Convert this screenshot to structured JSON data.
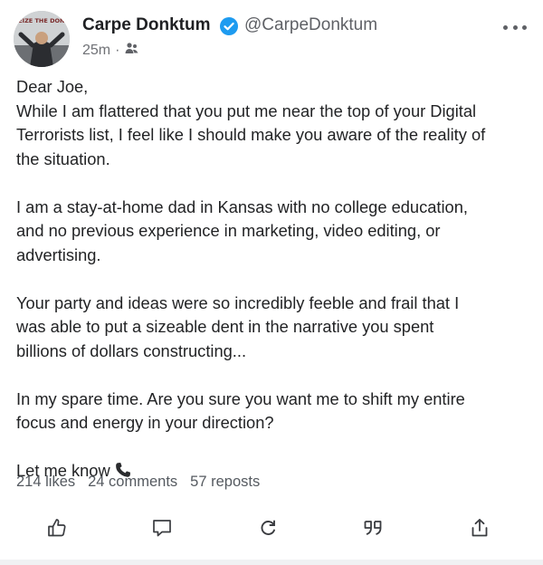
{
  "post": {
    "author_name": "Carpe Donktum",
    "handle": "@CarpeDonktum",
    "time": "25m",
    "meta_separator": "·",
    "avatar_caption": "SEIZE THE DONK",
    "body": {
      "greeting": "Dear Joe,",
      "para1": [
        "While I am flattered that you put me near the top of your Digital",
        "Terrorists list, I feel like I should make you aware of the reality of",
        "the situation."
      ],
      "para2": [
        "I am a stay-at-home dad in Kansas with no college education,",
        "and no previous experience in marketing, video editing, or",
        "advertising."
      ],
      "para3": [
        "Your party and ideas were so incredibly feeble and frail that I",
        "was able to put a sizeable dent in the narrative you spent",
        "billions of dollars constructing..."
      ],
      "para4": [
        "In my spare time. Are you sure you want me to shift my entire",
        "focus and energy in your direction?"
      ],
      "closing": "Let me know"
    },
    "stats": {
      "likes": "214 likes",
      "comments": "24 comments",
      "reposts": "57 reposts"
    },
    "actions": [
      "like-icon",
      "comment-icon",
      "repost-icon",
      "quote-icon",
      "share-icon"
    ]
  },
  "colors": {
    "verified": "#1d9bf0",
    "text": "#222325",
    "muted": "#5f6166"
  }
}
